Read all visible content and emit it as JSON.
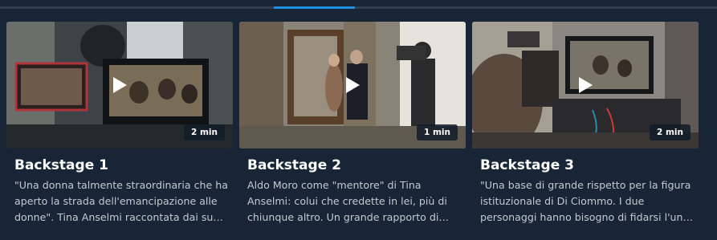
{
  "carousel": {
    "scroll_fraction": 0.43,
    "colors": {
      "background": "#172536",
      "track": "#2f3d4e",
      "thumb": "#1d8fe1"
    },
    "items": [
      {
        "title": "Backstage 1",
        "duration": "2 min",
        "description": "\"Una donna talmente straordinaria che ha aperto la strada dell'emancipazione alle donne\". Tina Anselmi raccontata dai suoi interpreti.",
        "play_icon": "play-icon"
      },
      {
        "title": "Backstage 2",
        "duration": "1 min",
        "description": "Aldo Moro come \"mentore\" di Tina Anselmi: colui che credette in lei, più di chiunque altro. Un grande rapporto di stima reciproca.",
        "play_icon": "play-icon"
      },
      {
        "title": "Backstage 3",
        "duration": "2 min",
        "description": "\"Una base di grande rispetto per la figura istituzionale di Di Ciommo. I due personaggi hanno bisogno di fidarsi l'uno dell'altra.",
        "play_icon": "play-icon"
      }
    ]
  }
}
